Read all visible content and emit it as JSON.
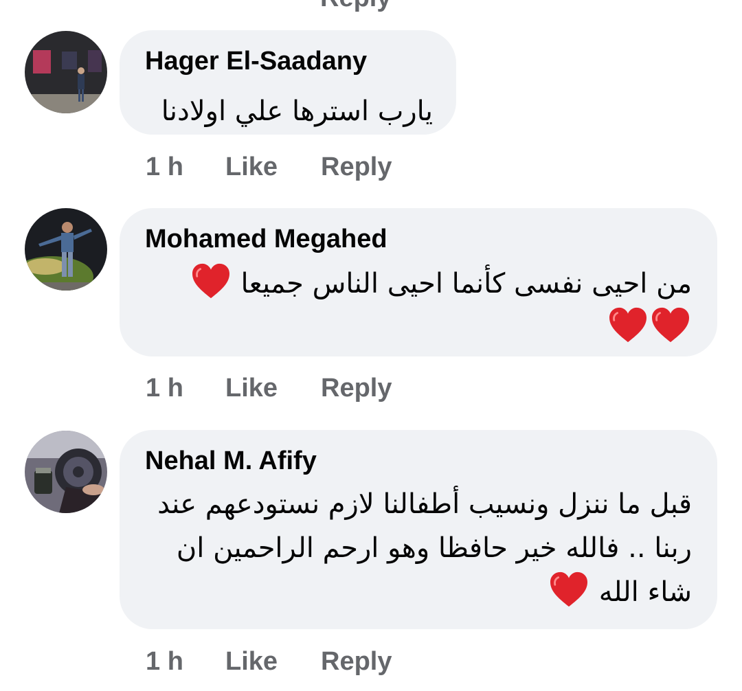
{
  "previous_reply_label": "Reply",
  "comments": [
    {
      "author": "Hager El-Saadany",
      "lines": [
        "يارب استرها علي اولادنا"
      ],
      "time": "1 h",
      "like_label": "Like",
      "reply_label": "Reply"
    },
    {
      "author": "Mohamed Megahed",
      "lines": [
        "من احيى نفسى كأنما احيى الناس جميعا"
      ],
      "time": "1 h",
      "like_label": "Like",
      "reply_label": "Reply",
      "emoji": [
        "red-heart",
        "red-heart",
        "red-heart"
      ]
    },
    {
      "author": "Nehal M. Afify",
      "lines": [
        "قبل ما ننزل ونسيب أطفالنا لازم نستودعهم عند",
        "ربنا .. فالله خير حافظا وهو ارحم الراحمين ان",
        "شاء الله"
      ],
      "time": "1 h",
      "like_label": "Like",
      "reply_label": "Reply",
      "emoji": [
        "red-heart"
      ]
    }
  ],
  "colors": {
    "bubble": "#f0f2f5",
    "text": "#050505",
    "meta": "#65676b",
    "heart": "#e0232b"
  }
}
